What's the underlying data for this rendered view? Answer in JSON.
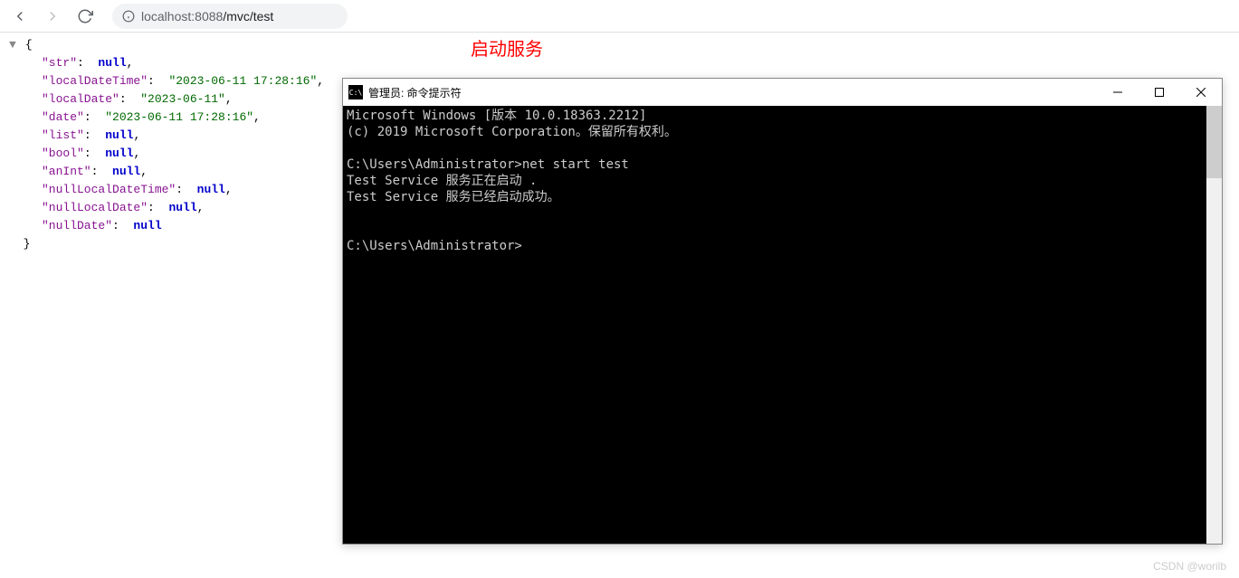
{
  "browser": {
    "url_host": "localhost:",
    "url_port": "8088",
    "url_path": "/mvc/test"
  },
  "annotation": "启动服务",
  "json": {
    "open": "{",
    "close": "}",
    "entries": [
      {
        "key": "\"str\"",
        "type": "null",
        "val": "null"
      },
      {
        "key": "\"localDateTime\"",
        "type": "str",
        "val": "\"2023-06-11 17:28:16\""
      },
      {
        "key": "\"localDate\"",
        "type": "str",
        "val": "\"2023-06-11\""
      },
      {
        "key": "\"date\"",
        "type": "str",
        "val": "\"2023-06-11 17:28:16\""
      },
      {
        "key": "\"list\"",
        "type": "null",
        "val": "null"
      },
      {
        "key": "\"bool\"",
        "type": "null",
        "val": "null"
      },
      {
        "key": "\"anInt\"",
        "type": "null",
        "val": "null"
      },
      {
        "key": "\"nullLocalDateTime\"",
        "type": "null",
        "val": "null"
      },
      {
        "key": "\"nullLocalDate\"",
        "type": "null",
        "val": "null"
      },
      {
        "key": "\"nullDate\"",
        "type": "null",
        "val": "null",
        "last": true
      }
    ]
  },
  "cmd": {
    "title": "管理员: 命令提示符",
    "lines": [
      "Microsoft Windows [版本 10.0.18363.2212]",
      "(c) 2019 Microsoft Corporation。保留所有权利。",
      "",
      "C:\\Users\\Administrator>net start test",
      "Test Service 服务正在启动 .",
      "Test Service 服务已经启动成功。",
      "",
      "",
      "C:\\Users\\Administrator>"
    ]
  },
  "watermark": "CSDN @worilb"
}
